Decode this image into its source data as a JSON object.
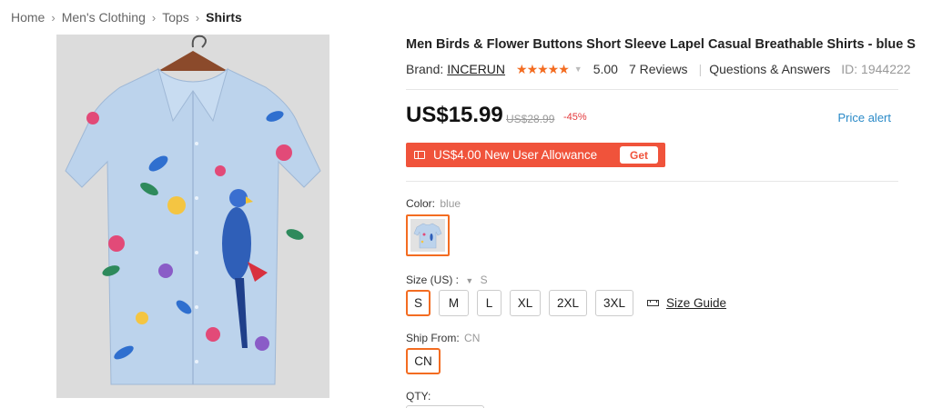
{
  "breadcrumb": [
    "Home",
    "Men's Clothing",
    "Tops",
    "Shirts"
  ],
  "product": {
    "title": "Men Birds & Flower Buttons Short Sleeve Lapel Casual Breathable Shirts - blue S",
    "brand_label": "Brand:",
    "brand_name": "INCERUN",
    "rating": "5.00",
    "stars": "★★★★★",
    "stars_filled": 5,
    "reviews": "7 Reviews",
    "qa": "Questions & Answers",
    "id": "ID: 1944222"
  },
  "price": {
    "current": "US$15.99",
    "original": "US$28.99",
    "discount": "-45%",
    "alert": "Price alert"
  },
  "allowance": {
    "text": "US$4.00 New User Allowance",
    "button": "Get"
  },
  "color": {
    "label": "Color:",
    "value": "blue"
  },
  "size": {
    "label": "Size (US) :",
    "value": "S",
    "options": [
      "S",
      "M",
      "L",
      "XL",
      "2XL",
      "3XL"
    ],
    "selected": "S",
    "guide": "Size Guide"
  },
  "ship": {
    "label": "Ship From:",
    "value": "CN",
    "option": "CN"
  },
  "qty": {
    "label": "QTY:"
  },
  "colors": {
    "accent": "#f36c21",
    "allowance_bg": "#f0533b",
    "link": "#2a8ac8",
    "discount": "#e4393c"
  }
}
